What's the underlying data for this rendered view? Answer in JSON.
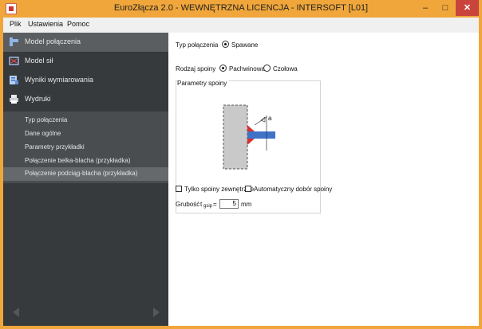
{
  "window": {
    "title": "EuroZłącza 2.0 - WEWNĘTRZNA LICENCJA - INTERSOFT [L01]",
    "min": "–",
    "max": "□",
    "close": "✕"
  },
  "menu": [
    "Plik",
    "Ustawienia",
    "Pomoc"
  ],
  "nav": [
    {
      "label": "Model połączenia",
      "icon": "connection-model-icon",
      "active": true
    },
    {
      "label": "Model sił",
      "icon": "force-model-icon",
      "active": false
    },
    {
      "label": "Wyniki wymiarowania",
      "icon": "results-icon",
      "active": false
    },
    {
      "label": "Wydruki",
      "icon": "printer-icon",
      "active": false
    }
  ],
  "sub": [
    {
      "label": "Typ połączenia",
      "active": false
    },
    {
      "label": "Dane ogólne",
      "active": false
    },
    {
      "label": "Parametry przykładki",
      "active": false
    },
    {
      "label": "Połączenie belka-blacha (przykładka)",
      "active": false
    },
    {
      "label": "Połączenie podciąg-blacha (przykładka)",
      "active": true
    }
  ],
  "content": {
    "type_label": "Typ połączenia",
    "type_option": "Spawane",
    "weld_type_label": "Rodzaj spoiny",
    "weld_options": [
      "Pachwinowa",
      "Czołowa"
    ],
    "weld_params_title": "Parametry spoiny",
    "diagram_label": "a",
    "outer_welds_label": "Tylko spoiny zewnętrzne",
    "auto_weld_label": "Automatyczny dobór spoiny",
    "thickness_label": "Grubość",
    "thickness_symbol": "t",
    "thickness_subscript": "gsip",
    "thickness_eq": "=",
    "thickness_value": "5",
    "thickness_unit": "mm"
  },
  "colors": {
    "accent": "#f0a63a",
    "sidebar": "#373a3d",
    "weld": "#d8312f",
    "plate": "#3e73c8"
  }
}
